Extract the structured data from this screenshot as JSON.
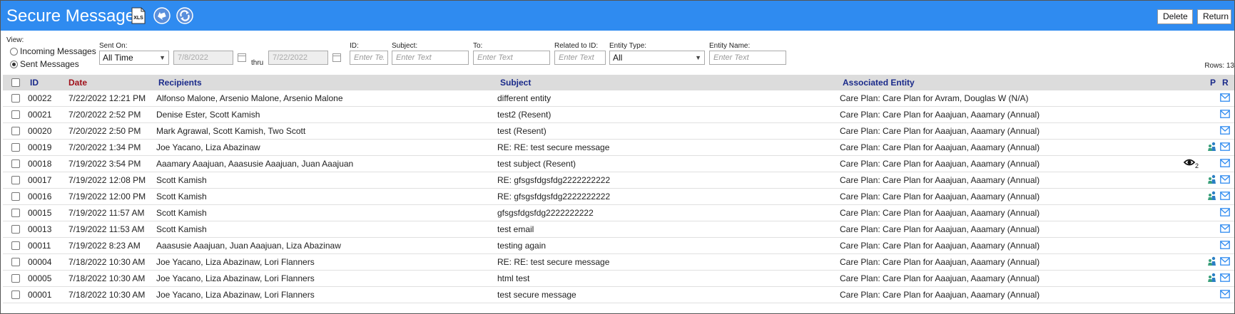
{
  "header": {
    "title": "Secure Messages",
    "xls_label": "XLS",
    "delete_label": "Delete",
    "return_label": "Return",
    "icons": [
      "xls-icon",
      "back-arrow-icon",
      "refresh-icon"
    ]
  },
  "filters": {
    "view_label": "View:",
    "incoming_label": "Incoming Messages",
    "sent_label": "Sent Messages",
    "sent_on_label": "Sent On:",
    "sent_on_value": "All Time",
    "from_date": "7/8/2022",
    "thru_label": "thru",
    "to_date": "7/22/2022",
    "id_label": "ID:",
    "id_placeholder": "Enter Text",
    "subject_label": "Subject:",
    "subject_placeholder": "Enter Text",
    "to_label": "To:",
    "to_placeholder": "Enter Text",
    "related_label": "Related to ID:",
    "related_placeholder": "Enter Text",
    "entity_type_label": "Entity Type:",
    "entity_type_value": "All",
    "entity_name_label": "Entity Name:",
    "entity_name_placeholder": "Enter Text",
    "rows_label": "Rows: 13"
  },
  "table": {
    "columns": {
      "id": "ID",
      "date": "Date",
      "recipients": "Recipients",
      "subject": "Subject",
      "entity": "Associated Entity",
      "p": "P",
      "r": "R"
    },
    "rows": [
      {
        "id": "00022",
        "date": "7/22/2022 12:21 PM",
        "recipients": "Alfonso Malone, Arsenio Malone, Arsenio Malone",
        "subject": "different entity",
        "entity": "Care Plan: Care Plan for Avram, Douglas W (N/A)",
        "portal": false,
        "eye": ""
      },
      {
        "id": "00021",
        "date": "7/20/2022 2:52 PM",
        "recipients": "Denise Ester, Scott Kamish",
        "subject": "test2 (Resent)",
        "entity": "Care Plan: Care Plan for Aaajuan, Aaamary (Annual)",
        "portal": false,
        "eye": ""
      },
      {
        "id": "00020",
        "date": "7/20/2022 2:50 PM",
        "recipients": "Mark Agrawal, Scott Kamish, Two Scott",
        "subject": "test (Resent)",
        "entity": "Care Plan: Care Plan for Aaajuan, Aaamary (Annual)",
        "portal": false,
        "eye": ""
      },
      {
        "id": "00019",
        "date": "7/20/2022 1:34 PM",
        "recipients": "Joe Yacano, Liza Abazinaw",
        "subject": "RE: RE: test secure message",
        "entity": "Care Plan: Care Plan for Aaajuan, Aaamary (Annual)",
        "portal": true,
        "eye": ""
      },
      {
        "id": "00018",
        "date": "7/19/2022 3:54 PM",
        "recipients": "Aaamary Aaajuan, Aaasusie Aaajuan, Juan Aaajuan",
        "subject": "test subject (Resent)",
        "entity": "Care Plan: Care Plan for Aaajuan, Aaamary (Annual)",
        "portal": false,
        "eye": "2"
      },
      {
        "id": "00017",
        "date": "7/19/2022 12:08 PM",
        "recipients": "Scott Kamish",
        "subject": "RE: gfsgsfdgsfdg2222222222",
        "entity": "Care Plan: Care Plan for Aaajuan, Aaamary (Annual)",
        "portal": true,
        "eye": ""
      },
      {
        "id": "00016",
        "date": "7/19/2022 12:00 PM",
        "recipients": "Scott Kamish",
        "subject": "RE: gfsgsfdgsfdg2222222222",
        "entity": "Care Plan: Care Plan for Aaajuan, Aaamary (Annual)",
        "portal": true,
        "eye": ""
      },
      {
        "id": "00015",
        "date": "7/19/2022 11:57 AM",
        "recipients": "Scott Kamish",
        "subject": "gfsgsfdgsfdg2222222222",
        "entity": "Care Plan: Care Plan for Aaajuan, Aaamary (Annual)",
        "portal": false,
        "eye": ""
      },
      {
        "id": "00013",
        "date": "7/19/2022 11:53 AM",
        "recipients": "Scott Kamish",
        "subject": "test email",
        "entity": "Care Plan: Care Plan for Aaajuan, Aaamary (Annual)",
        "portal": false,
        "eye": ""
      },
      {
        "id": "00011",
        "date": "7/19/2022 8:23 AM",
        "recipients": "Aaasusie Aaajuan, Juan Aaajuan, Liza Abazinaw",
        "subject": "testing again",
        "entity": "Care Plan: Care Plan for Aaajuan, Aaamary (Annual)",
        "portal": false,
        "eye": ""
      },
      {
        "id": "00004",
        "date": "7/18/2022 10:30 AM",
        "recipients": "Joe Yacano, Liza Abazinaw, Lori Flanners",
        "subject": "RE: RE: test secure message",
        "entity": "Care Plan: Care Plan for Aaajuan, Aaamary (Annual)",
        "portal": true,
        "eye": ""
      },
      {
        "id": "00005",
        "date": "7/18/2022 10:30 AM",
        "recipients": "Joe Yacano, Liza Abazinaw, Lori Flanners",
        "subject": "html test",
        "entity": "Care Plan: Care Plan for Aaajuan, Aaamary (Annual)",
        "portal": true,
        "eye": ""
      },
      {
        "id": "00001",
        "date": "7/18/2022 10:30 AM",
        "recipients": "Joe Yacano, Liza Abazinaw, Lori Flanners",
        "subject": "test secure message",
        "entity": "Care Plan: Care Plan for Aaajuan, Aaamary (Annual)",
        "portal": false,
        "eye": ""
      }
    ]
  },
  "colors": {
    "header_bg": "#2f8bf0",
    "table_header_bg": "#dcdcdc",
    "header_text_blue": "#1a2a8a",
    "header_text_red": "#a0101a",
    "icon_blue": "#2f8bf0"
  }
}
